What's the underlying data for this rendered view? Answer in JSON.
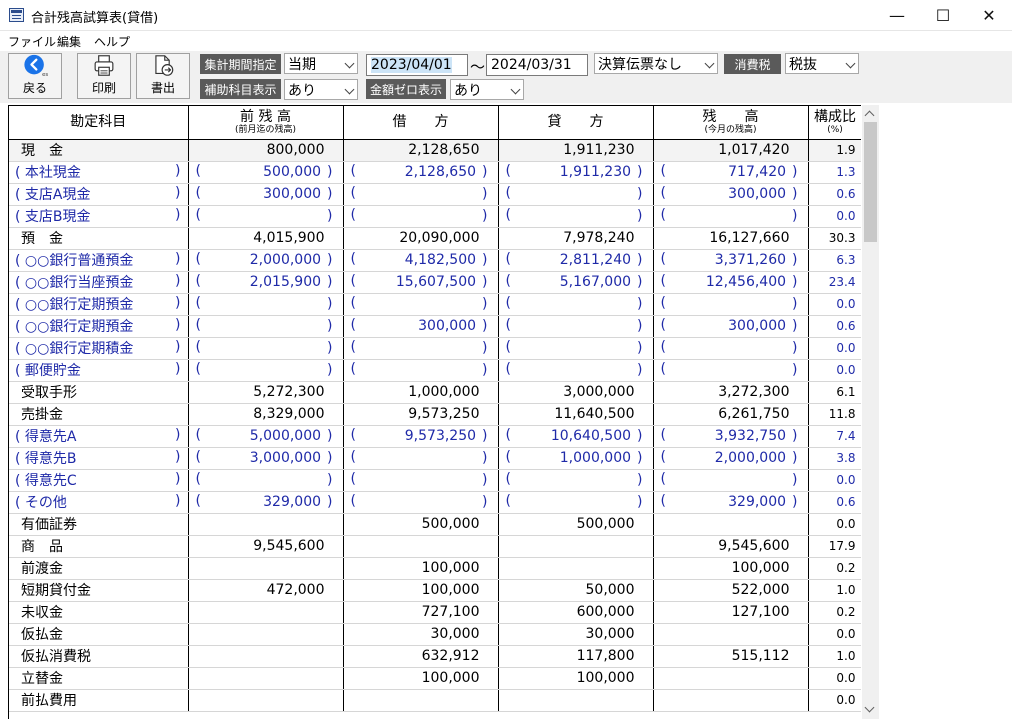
{
  "window": {
    "title": "合計残高試算表(貸借)",
    "minimize": "—",
    "maximize": "☐",
    "close": "✕"
  },
  "menu": [
    "ファイル",
    "編集",
    "ヘルプ"
  ],
  "toolbar": {
    "back_label": "戻る",
    "back_key": "esc",
    "print_label": "印刷",
    "export_label": "書出",
    "period_label": "集計期間指定",
    "period_value": "当期",
    "sub_display_label": "補助科目表示",
    "sub_display_value": "あり",
    "date_from": "2023/04/01",
    "tilde": "〜",
    "date_to": "2024/03/31",
    "settlement_value": "決算伝票なし",
    "tax_label": "消費税",
    "tax_value": "税抜",
    "zero_label": "金額ゼロ表示",
    "zero_value": "あり"
  },
  "columns": {
    "account": "勘定科目",
    "prev_main": "前 残 高",
    "prev_sub": "(前月迄の残高)",
    "debit": "借　　方",
    "credit": "貸　　方",
    "balance_main": "残　　高",
    "balance_sub": "(今月の残高)",
    "ratio_main": "構成比",
    "ratio_sub": "(%)"
  },
  "rows": [
    {
      "type": "group",
      "name": "現　金",
      "prev": "800,000",
      "debit": "2,128,650",
      "credit": "1,911,230",
      "balance": "1,017,420",
      "ratio": "1.9"
    },
    {
      "type": "sub",
      "name": "本社現金",
      "prev": "500,000",
      "debit": "2,128,650",
      "credit": "1,911,230",
      "balance": "717,420",
      "ratio": "1.3"
    },
    {
      "type": "sub",
      "name": "支店A現金",
      "prev": "300,000",
      "debit": "",
      "credit": "",
      "balance": "300,000",
      "ratio": "0.6"
    },
    {
      "type": "sub",
      "name": "支店B現金",
      "prev": "",
      "debit": "",
      "credit": "",
      "balance": "",
      "ratio": "0.0"
    },
    {
      "type": "main",
      "name": "預　金",
      "prev": "4,015,900",
      "debit": "20,090,000",
      "credit": "7,978,240",
      "balance": "16,127,660",
      "ratio": "30.3"
    },
    {
      "type": "sub",
      "name": "○○銀行普通預金",
      "prev": "2,000,000",
      "debit": "4,182,500",
      "credit": "2,811,240",
      "balance": "3,371,260",
      "ratio": "6.3"
    },
    {
      "type": "sub",
      "name": "○○銀行当座預金",
      "prev": "2,015,900",
      "debit": "15,607,500",
      "credit": "5,167,000",
      "balance": "12,456,400",
      "ratio": "23.4"
    },
    {
      "type": "sub",
      "name": "○○銀行定期預金",
      "prev": "",
      "debit": "",
      "credit": "",
      "balance": "",
      "ratio": "0.0"
    },
    {
      "type": "sub",
      "name": "○○銀行定期預金",
      "prev": "",
      "debit": "300,000",
      "credit": "",
      "balance": "300,000",
      "ratio": "0.6"
    },
    {
      "type": "sub",
      "name": "○○銀行定期積金",
      "prev": "",
      "debit": "",
      "credit": "",
      "balance": "",
      "ratio": "0.0"
    },
    {
      "type": "sub",
      "name": "郵便貯金",
      "prev": "",
      "debit": "",
      "credit": "",
      "balance": "",
      "ratio": "0.0"
    },
    {
      "type": "main",
      "name": "受取手形",
      "prev": "5,272,300",
      "debit": "1,000,000",
      "credit": "3,000,000",
      "balance": "3,272,300",
      "ratio": "6.1"
    },
    {
      "type": "main",
      "name": "売掛金",
      "prev": "8,329,000",
      "debit": "9,573,250",
      "credit": "11,640,500",
      "balance": "6,261,750",
      "ratio": "11.8"
    },
    {
      "type": "sub",
      "name": "得意先A",
      "prev": "5,000,000",
      "debit": "9,573,250",
      "credit": "10,640,500",
      "balance": "3,932,750",
      "ratio": "7.4"
    },
    {
      "type": "sub",
      "name": "得意先B",
      "prev": "3,000,000",
      "debit": "",
      "credit": "1,000,000",
      "balance": "2,000,000",
      "ratio": "3.8"
    },
    {
      "type": "sub",
      "name": "得意先C",
      "prev": "",
      "debit": "",
      "credit": "",
      "balance": "",
      "ratio": "0.0"
    },
    {
      "type": "sub",
      "name": "その他",
      "prev": "329,000",
      "debit": "",
      "credit": "",
      "balance": "329,000",
      "ratio": "0.6"
    },
    {
      "type": "main",
      "name": "有価証券",
      "prev": "",
      "debit": "500,000",
      "credit": "500,000",
      "balance": "",
      "ratio": "0.0"
    },
    {
      "type": "main",
      "name": "商　品",
      "prev": "9,545,600",
      "debit": "",
      "credit": "",
      "balance": "9,545,600",
      "ratio": "17.9"
    },
    {
      "type": "main",
      "name": "前渡金",
      "prev": "",
      "debit": "100,000",
      "credit": "",
      "balance": "100,000",
      "ratio": "0.2"
    },
    {
      "type": "main",
      "name": "短期貸付金",
      "prev": "472,000",
      "debit": "100,000",
      "credit": "50,000",
      "balance": "522,000",
      "ratio": "1.0"
    },
    {
      "type": "main",
      "name": "未収金",
      "prev": "",
      "debit": "727,100",
      "credit": "600,000",
      "balance": "127,100",
      "ratio": "0.2"
    },
    {
      "type": "main",
      "name": "仮払金",
      "prev": "",
      "debit": "30,000",
      "credit": "30,000",
      "balance": "",
      "ratio": "0.0"
    },
    {
      "type": "main",
      "name": "仮払消費税",
      "prev": "",
      "debit": "632,912",
      "credit": "117,800",
      "balance": "515,112",
      "ratio": "1.0"
    },
    {
      "type": "main",
      "name": "立替金",
      "prev": "",
      "debit": "100,000",
      "credit": "100,000",
      "balance": "",
      "ratio": "0.0"
    },
    {
      "type": "main",
      "name": "前払費用",
      "prev": "",
      "debit": "",
      "credit": "",
      "balance": "",
      "ratio": "0.0"
    }
  ],
  "colors": {
    "sub_text": "#1f2aa8",
    "back_button": "#1a73e8",
    "label_bg": "#5a5a5a",
    "selection": "#cce4f7"
  }
}
